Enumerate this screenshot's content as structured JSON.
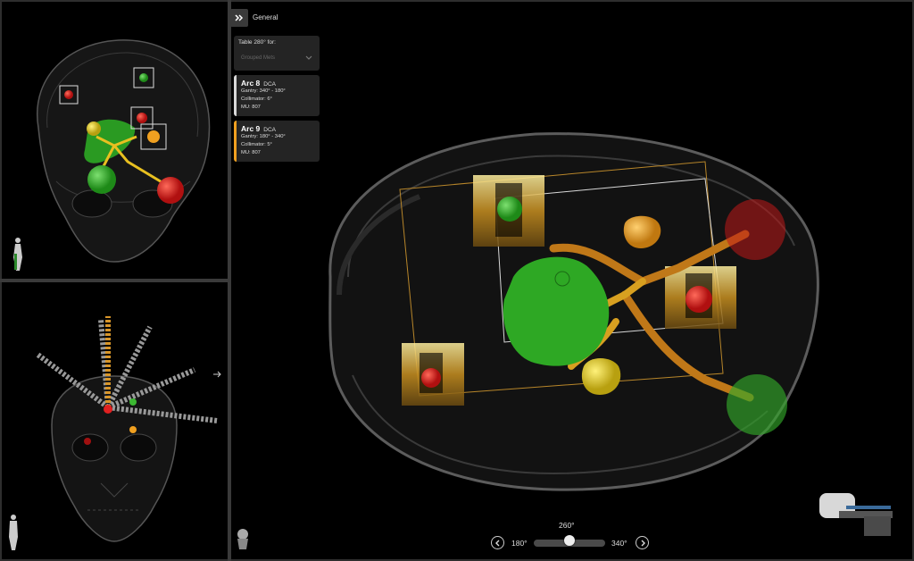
{
  "panel": {
    "toggle_icon": "double-chevron-right-icon",
    "title": "General",
    "table": {
      "label": "Table 280° for:",
      "placeholder": "Grouped Mets"
    },
    "arcs": [
      {
        "name": "Arc 8",
        "type": "DCA",
        "gantry": "Gantry: 340° - 180°",
        "collimator": "Collimator: 6°",
        "mu": "MU: 807",
        "color": "#d8d8d8"
      },
      {
        "name": "Arc 9",
        "type": "DCA",
        "gantry": "Gantry: 180° - 340°",
        "collimator": "Collimator: 5°",
        "mu": "MU: 807",
        "color": "#f0a020"
      }
    ]
  },
  "slider": {
    "current": "260°",
    "min_label": "180°",
    "max_label": "340°",
    "fraction": 0.25,
    "prev_icon": "chevron-left-circle-icon",
    "next_icon": "chevron-right-circle-icon"
  },
  "colors": {
    "tumor_green": "#3cb832",
    "tumor_red": "#e02020",
    "tumor_yellow": "#e8d028",
    "tumor_orange": "#f0a020",
    "arc_orange": "#d8962a",
    "background": "#000000",
    "panel": "#242424"
  }
}
